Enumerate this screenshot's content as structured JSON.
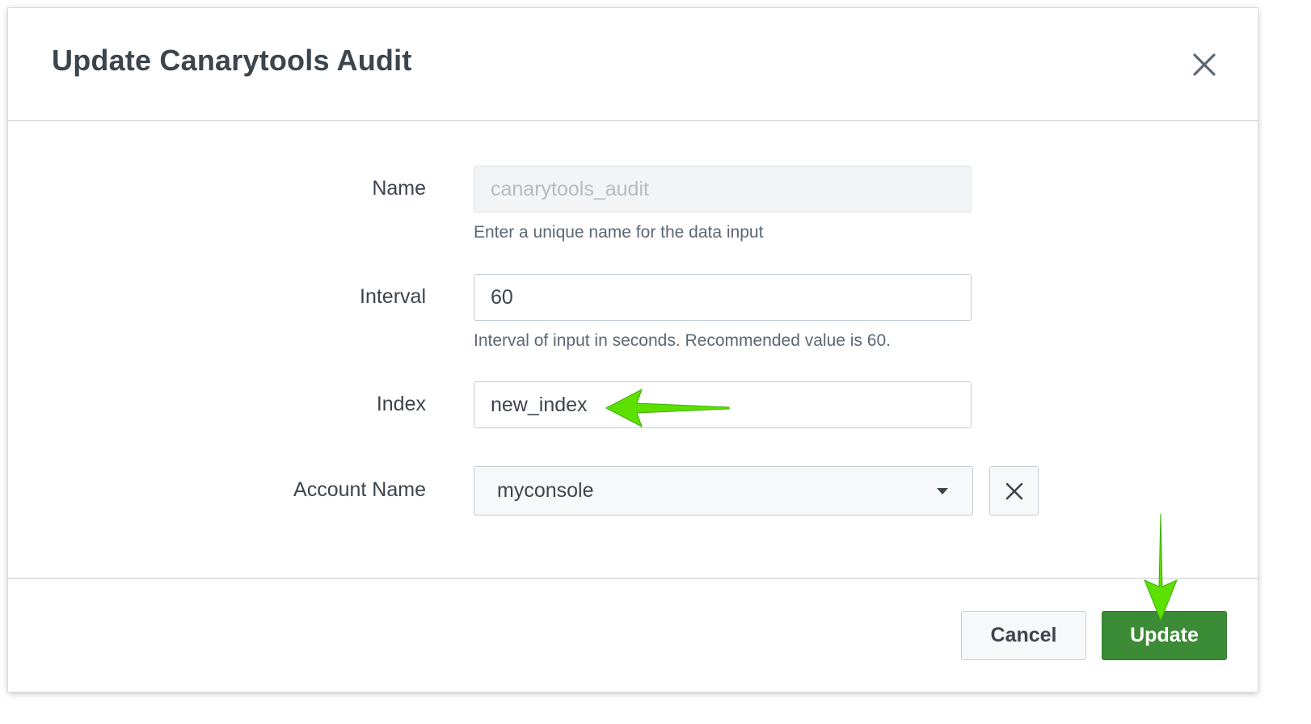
{
  "dialog": {
    "title": "Update Canarytools Audit",
    "close_icon": "close-icon"
  },
  "form": {
    "name": {
      "label": "Name",
      "value": "canarytools_audit",
      "help": "Enter a unique name for the data input",
      "disabled": true
    },
    "interval": {
      "label": "Interval",
      "value": "60",
      "help": "Interval of input in seconds. Recommended value is 60."
    },
    "index": {
      "label": "Index",
      "value": "new_index"
    },
    "account_name": {
      "label": "Account Name",
      "selected": "myconsole",
      "dropdown_icon": "chevron-down-icon",
      "clear_icon": "close-icon"
    }
  },
  "footer": {
    "cancel_label": "Cancel",
    "update_label": "Update"
  },
  "annotations": {
    "arrow_color": "#5ce000"
  },
  "colors": {
    "primary_button": "#3c8b36",
    "text": "#3c444d",
    "help_text": "#5c6773"
  }
}
